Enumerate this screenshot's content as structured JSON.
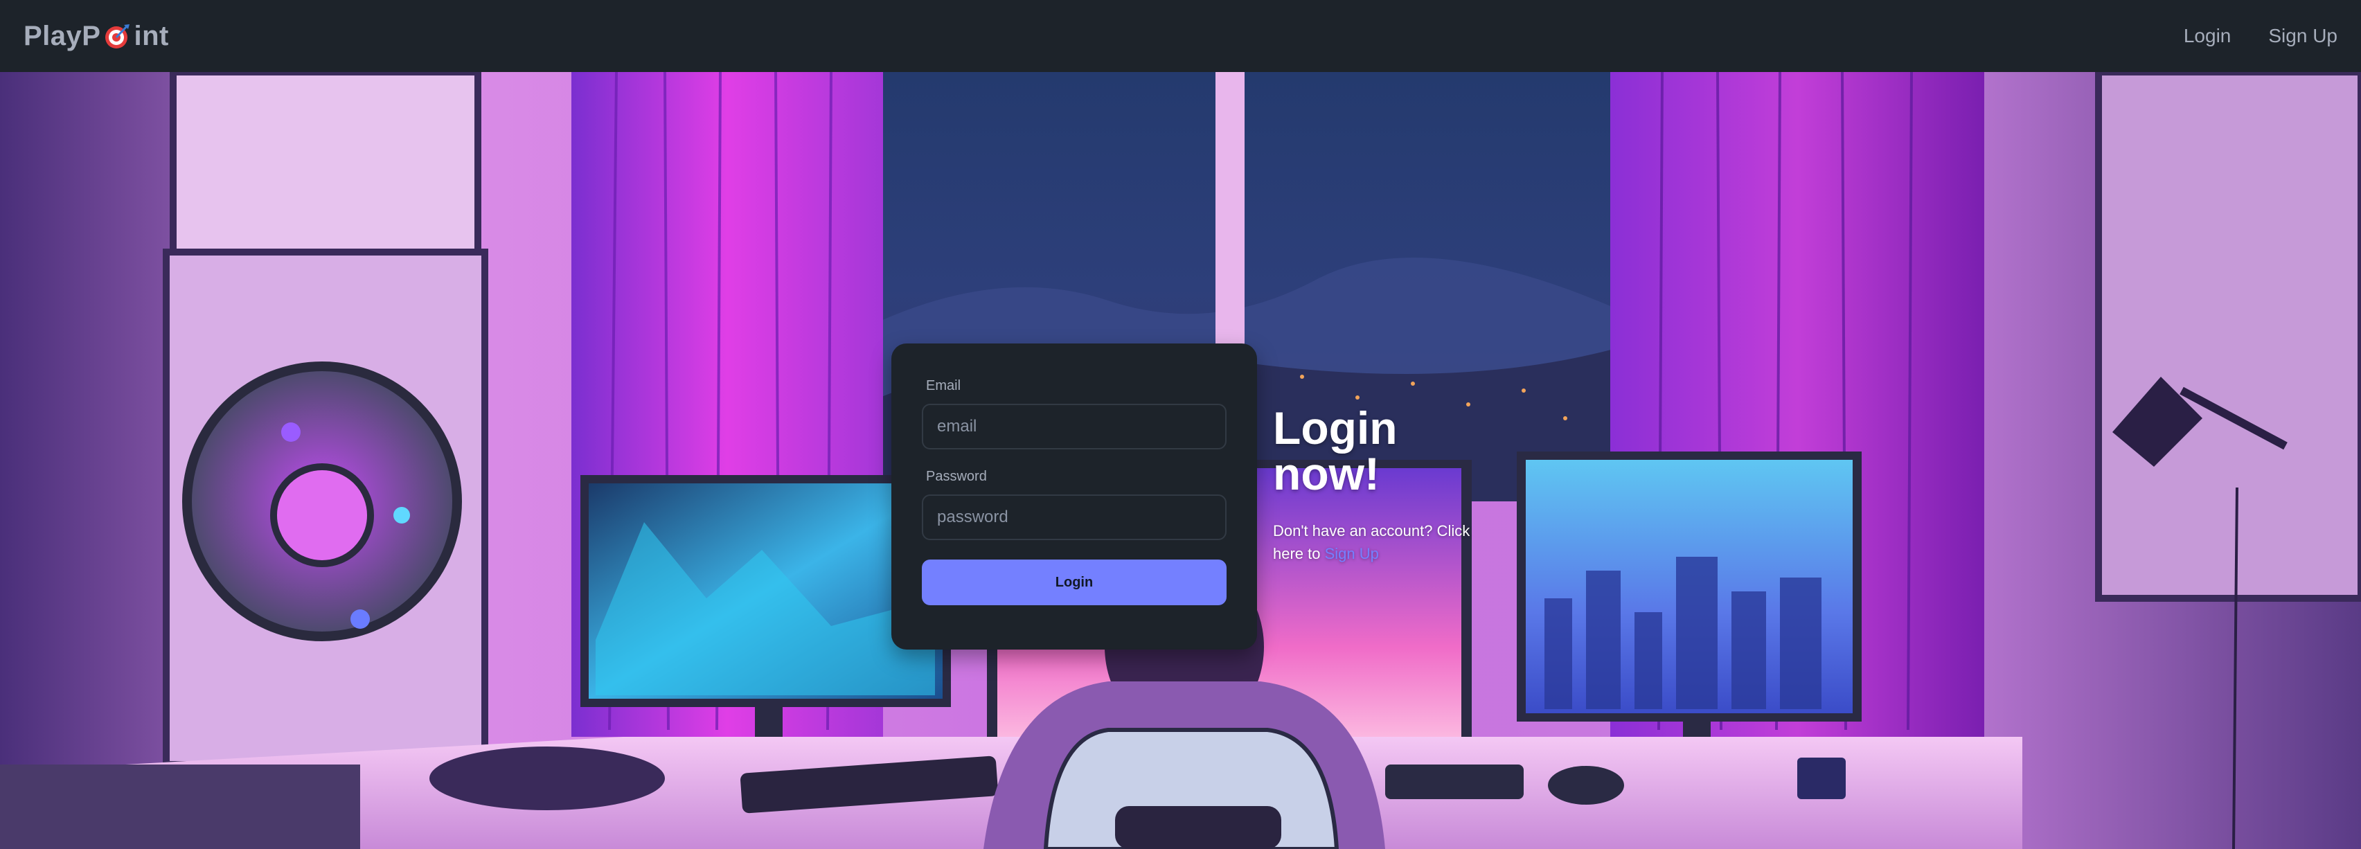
{
  "navbar": {
    "brand_before": "PlayP",
    "brand_icon": "target-icon",
    "brand_after": "int",
    "login_link": "Login",
    "signup_link": "Sign Up"
  },
  "login_form": {
    "email_label": "Email",
    "email_placeholder": "email",
    "password_label": "Password",
    "password_placeholder": "password",
    "submit_label": "Login"
  },
  "hero": {
    "headline": "Login now!",
    "subtext_prefix": "Don't have an account? Click here to ",
    "signup_link": "Sign Up"
  },
  "colors": {
    "navbar_bg": "#1d232a",
    "card_bg": "#1d232a",
    "primary": "#7480ff",
    "text_muted": "#a6adbb"
  }
}
